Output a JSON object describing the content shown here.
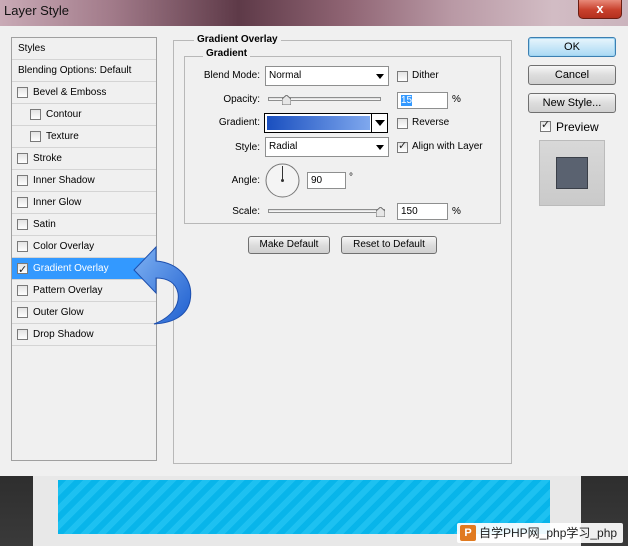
{
  "window": {
    "title": "Layer Style",
    "close_glyph": "x"
  },
  "sidebar": {
    "styles_header": "Styles",
    "blending_header": "Blending Options: Default",
    "items": [
      {
        "label": "Bevel & Emboss",
        "checked": false,
        "indent": 0
      },
      {
        "label": "Contour",
        "checked": false,
        "indent": 1
      },
      {
        "label": "Texture",
        "checked": false,
        "indent": 1
      },
      {
        "label": "Stroke",
        "checked": false,
        "indent": 0
      },
      {
        "label": "Inner Shadow",
        "checked": false,
        "indent": 0
      },
      {
        "label": "Inner Glow",
        "checked": false,
        "indent": 0
      },
      {
        "label": "Satin",
        "checked": false,
        "indent": 0
      },
      {
        "label": "Color Overlay",
        "checked": false,
        "indent": 0
      },
      {
        "label": "Gradient Overlay",
        "checked": true,
        "indent": 0,
        "selected": true
      },
      {
        "label": "Pattern Overlay",
        "checked": false,
        "indent": 0
      },
      {
        "label": "Outer Glow",
        "checked": false,
        "indent": 0
      },
      {
        "label": "Drop Shadow",
        "checked": false,
        "indent": 0
      }
    ]
  },
  "panel": {
    "title": "Gradient Overlay",
    "subtitle": "Gradient",
    "blend_mode_label": "Blend Mode:",
    "blend_mode_value": "Normal",
    "dither_label": "Dither",
    "dither_checked": false,
    "opacity_label": "Opacity:",
    "opacity_value": "15",
    "opacity_unit": "%",
    "gradient_label": "Gradient:",
    "reverse_label": "Reverse",
    "reverse_checked": false,
    "style_label": "Style:",
    "style_value": "Radial",
    "align_label": "Align with Layer",
    "align_checked": true,
    "angle_label": "Angle:",
    "angle_value": "90",
    "angle_unit": "°",
    "scale_label": "Scale:",
    "scale_value": "150",
    "scale_unit": "%",
    "make_default_label": "Make Default",
    "reset_default_label": "Reset to Default"
  },
  "actions": {
    "ok_label": "OK",
    "cancel_label": "Cancel",
    "new_style_label": "New Style...",
    "preview_label": "Preview",
    "preview_checked": true
  },
  "watermark": {
    "logo": "P",
    "text": "自学PHP网_php学习_php数"
  },
  "colors": {
    "selection": "#3399ff",
    "gradient_start": "#1a4fbf",
    "gradient_end": "#7fa8ee",
    "canvas_blue": "#08b5ea"
  }
}
